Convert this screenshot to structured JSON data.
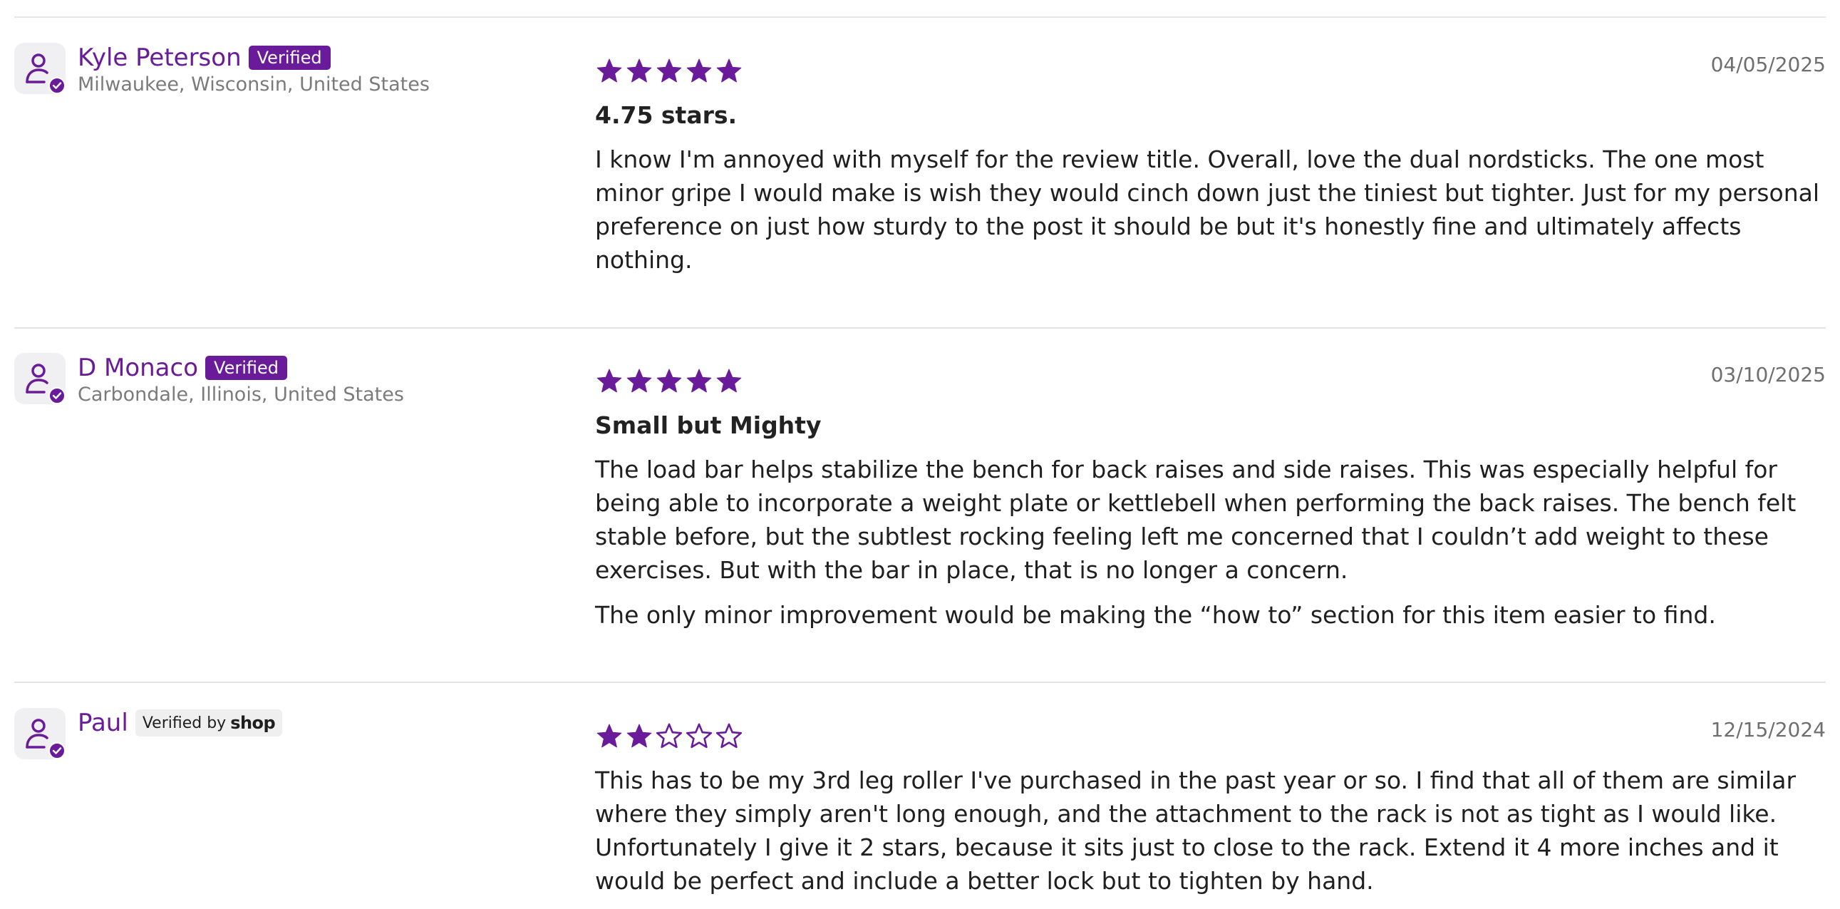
{
  "colors": {
    "accent": "#6a1b9a",
    "divider": "#e4e4e4",
    "muted_text": "#7b7b7b",
    "body_text": "#1f1f1f"
  },
  "icons": {
    "avatar": "user-icon",
    "verified_check": "checkmark-icon",
    "star_filled": "star-filled-icon",
    "star_empty": "star-outline-icon"
  },
  "reviews": [
    {
      "author": "Kyle Peterson",
      "badge": "Verified",
      "location": "Milwaukee, Wisconsin, United States",
      "rating": 5,
      "date": "04/05/2025",
      "title": "4.75 stars.",
      "paragraphs": [
        "I know I'm annoyed with myself for the review title. Overall, love the dual nordsticks. The one most minor gripe I would make is wish they would cinch down just the tiniest but tighter. Just for my personal preference on just how sturdy to the post it should be but it's honestly fine and ultimately affects nothing."
      ]
    },
    {
      "author": "D Monaco",
      "badge": "Verified",
      "location": "Carbondale, Illinois, United States",
      "rating": 5,
      "date": "03/10/2025",
      "title": "Small but Mighty",
      "paragraphs": [
        "The load bar helps stabilize the bench for back raises and side raises. This was especially helpful for being able to incorporate a weight plate or kettlebell when performing the back raises. The bench felt stable before, but the subtlest rocking feeling left me concerned that I couldn’t add weight to these exercises. But with the bar in place, that is no longer a concern.",
        "The only minor improvement would be making the “how to” section for this item easier to find."
      ]
    },
    {
      "author": "Paul",
      "badge_prefix": "Verified by",
      "badge_brand": "shop",
      "location": "",
      "rating": 2,
      "date": "12/15/2024",
      "title": "",
      "paragraphs": [
        "This has to be my 3rd leg roller I've purchased in the past year or so. I find that all of them are similar where they simply aren't long enough, and the attachment to the rack is not as tight as I would like. Unfortunately I give it 2 stars, because it sits just to close to the rack. Extend it 4 more inches and it would be perfect and include a better lock but to tighten by hand."
      ]
    }
  ]
}
